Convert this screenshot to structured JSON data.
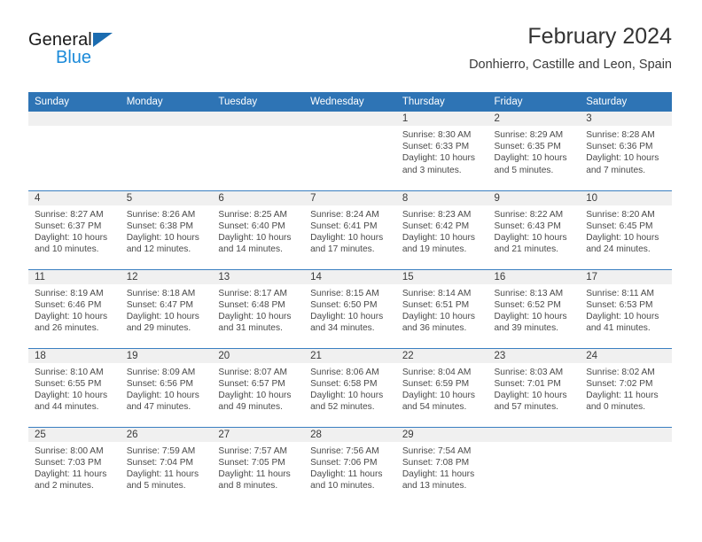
{
  "brand": {
    "name_part1": "General",
    "name_part2": "Blue",
    "triangle_icon": "logo-triangle",
    "accent_dark": "#1b6cb0",
    "accent_light": "#1b8ad9"
  },
  "header": {
    "title": "February 2024",
    "subtitle": "Donhierro, Castille and Leon, Spain"
  },
  "theme": {
    "header_blue": "#2e74b5",
    "row_divider": "#3a7fc1",
    "daynum_bg": "#f0f0f0"
  },
  "weekdays": [
    "Sunday",
    "Monday",
    "Tuesday",
    "Wednesday",
    "Thursday",
    "Friday",
    "Saturday"
  ],
  "weeks": [
    [
      {
        "day": "",
        "sunrise": "",
        "sunset": "",
        "daylight_line1": "",
        "daylight_line2": ""
      },
      {
        "day": "",
        "sunrise": "",
        "sunset": "",
        "daylight_line1": "",
        "daylight_line2": ""
      },
      {
        "day": "",
        "sunrise": "",
        "sunset": "",
        "daylight_line1": "",
        "daylight_line2": ""
      },
      {
        "day": "",
        "sunrise": "",
        "sunset": "",
        "daylight_line1": "",
        "daylight_line2": ""
      },
      {
        "day": "1",
        "sunrise": "Sunrise: 8:30 AM",
        "sunset": "Sunset: 6:33 PM",
        "daylight_line1": "Daylight: 10 hours",
        "daylight_line2": "and 3 minutes."
      },
      {
        "day": "2",
        "sunrise": "Sunrise: 8:29 AM",
        "sunset": "Sunset: 6:35 PM",
        "daylight_line1": "Daylight: 10 hours",
        "daylight_line2": "and 5 minutes."
      },
      {
        "day": "3",
        "sunrise": "Sunrise: 8:28 AM",
        "sunset": "Sunset: 6:36 PM",
        "daylight_line1": "Daylight: 10 hours",
        "daylight_line2": "and 7 minutes."
      }
    ],
    [
      {
        "day": "4",
        "sunrise": "Sunrise: 8:27 AM",
        "sunset": "Sunset: 6:37 PM",
        "daylight_line1": "Daylight: 10 hours",
        "daylight_line2": "and 10 minutes."
      },
      {
        "day": "5",
        "sunrise": "Sunrise: 8:26 AM",
        "sunset": "Sunset: 6:38 PM",
        "daylight_line1": "Daylight: 10 hours",
        "daylight_line2": "and 12 minutes."
      },
      {
        "day": "6",
        "sunrise": "Sunrise: 8:25 AM",
        "sunset": "Sunset: 6:40 PM",
        "daylight_line1": "Daylight: 10 hours",
        "daylight_line2": "and 14 minutes."
      },
      {
        "day": "7",
        "sunrise": "Sunrise: 8:24 AM",
        "sunset": "Sunset: 6:41 PM",
        "daylight_line1": "Daylight: 10 hours",
        "daylight_line2": "and 17 minutes."
      },
      {
        "day": "8",
        "sunrise": "Sunrise: 8:23 AM",
        "sunset": "Sunset: 6:42 PM",
        "daylight_line1": "Daylight: 10 hours",
        "daylight_line2": "and 19 minutes."
      },
      {
        "day": "9",
        "sunrise": "Sunrise: 8:22 AM",
        "sunset": "Sunset: 6:43 PM",
        "daylight_line1": "Daylight: 10 hours",
        "daylight_line2": "and 21 minutes."
      },
      {
        "day": "10",
        "sunrise": "Sunrise: 8:20 AM",
        "sunset": "Sunset: 6:45 PM",
        "daylight_line1": "Daylight: 10 hours",
        "daylight_line2": "and 24 minutes."
      }
    ],
    [
      {
        "day": "11",
        "sunrise": "Sunrise: 8:19 AM",
        "sunset": "Sunset: 6:46 PM",
        "daylight_line1": "Daylight: 10 hours",
        "daylight_line2": "and 26 minutes."
      },
      {
        "day": "12",
        "sunrise": "Sunrise: 8:18 AM",
        "sunset": "Sunset: 6:47 PM",
        "daylight_line1": "Daylight: 10 hours",
        "daylight_line2": "and 29 minutes."
      },
      {
        "day": "13",
        "sunrise": "Sunrise: 8:17 AM",
        "sunset": "Sunset: 6:48 PM",
        "daylight_line1": "Daylight: 10 hours",
        "daylight_line2": "and 31 minutes."
      },
      {
        "day": "14",
        "sunrise": "Sunrise: 8:15 AM",
        "sunset": "Sunset: 6:50 PM",
        "daylight_line1": "Daylight: 10 hours",
        "daylight_line2": "and 34 minutes."
      },
      {
        "day": "15",
        "sunrise": "Sunrise: 8:14 AM",
        "sunset": "Sunset: 6:51 PM",
        "daylight_line1": "Daylight: 10 hours",
        "daylight_line2": "and 36 minutes."
      },
      {
        "day": "16",
        "sunrise": "Sunrise: 8:13 AM",
        "sunset": "Sunset: 6:52 PM",
        "daylight_line1": "Daylight: 10 hours",
        "daylight_line2": "and 39 minutes."
      },
      {
        "day": "17",
        "sunrise": "Sunrise: 8:11 AM",
        "sunset": "Sunset: 6:53 PM",
        "daylight_line1": "Daylight: 10 hours",
        "daylight_line2": "and 41 minutes."
      }
    ],
    [
      {
        "day": "18",
        "sunrise": "Sunrise: 8:10 AM",
        "sunset": "Sunset: 6:55 PM",
        "daylight_line1": "Daylight: 10 hours",
        "daylight_line2": "and 44 minutes."
      },
      {
        "day": "19",
        "sunrise": "Sunrise: 8:09 AM",
        "sunset": "Sunset: 6:56 PM",
        "daylight_line1": "Daylight: 10 hours",
        "daylight_line2": "and 47 minutes."
      },
      {
        "day": "20",
        "sunrise": "Sunrise: 8:07 AM",
        "sunset": "Sunset: 6:57 PM",
        "daylight_line1": "Daylight: 10 hours",
        "daylight_line2": "and 49 minutes."
      },
      {
        "day": "21",
        "sunrise": "Sunrise: 8:06 AM",
        "sunset": "Sunset: 6:58 PM",
        "daylight_line1": "Daylight: 10 hours",
        "daylight_line2": "and 52 minutes."
      },
      {
        "day": "22",
        "sunrise": "Sunrise: 8:04 AM",
        "sunset": "Sunset: 6:59 PM",
        "daylight_line1": "Daylight: 10 hours",
        "daylight_line2": "and 54 minutes."
      },
      {
        "day": "23",
        "sunrise": "Sunrise: 8:03 AM",
        "sunset": "Sunset: 7:01 PM",
        "daylight_line1": "Daylight: 10 hours",
        "daylight_line2": "and 57 minutes."
      },
      {
        "day": "24",
        "sunrise": "Sunrise: 8:02 AM",
        "sunset": "Sunset: 7:02 PM",
        "daylight_line1": "Daylight: 11 hours",
        "daylight_line2": "and 0 minutes."
      }
    ],
    [
      {
        "day": "25",
        "sunrise": "Sunrise: 8:00 AM",
        "sunset": "Sunset: 7:03 PM",
        "daylight_line1": "Daylight: 11 hours",
        "daylight_line2": "and 2 minutes."
      },
      {
        "day": "26",
        "sunrise": "Sunrise: 7:59 AM",
        "sunset": "Sunset: 7:04 PM",
        "daylight_line1": "Daylight: 11 hours",
        "daylight_line2": "and 5 minutes."
      },
      {
        "day": "27",
        "sunrise": "Sunrise: 7:57 AM",
        "sunset": "Sunset: 7:05 PM",
        "daylight_line1": "Daylight: 11 hours",
        "daylight_line2": "and 8 minutes."
      },
      {
        "day": "28",
        "sunrise": "Sunrise: 7:56 AM",
        "sunset": "Sunset: 7:06 PM",
        "daylight_line1": "Daylight: 11 hours",
        "daylight_line2": "and 10 minutes."
      },
      {
        "day": "29",
        "sunrise": "Sunrise: 7:54 AM",
        "sunset": "Sunset: 7:08 PM",
        "daylight_line1": "Daylight: 11 hours",
        "daylight_line2": "and 13 minutes."
      },
      {
        "day": "",
        "sunrise": "",
        "sunset": "",
        "daylight_line1": "",
        "daylight_line2": ""
      },
      {
        "day": "",
        "sunrise": "",
        "sunset": "",
        "daylight_line1": "",
        "daylight_line2": ""
      }
    ]
  ]
}
